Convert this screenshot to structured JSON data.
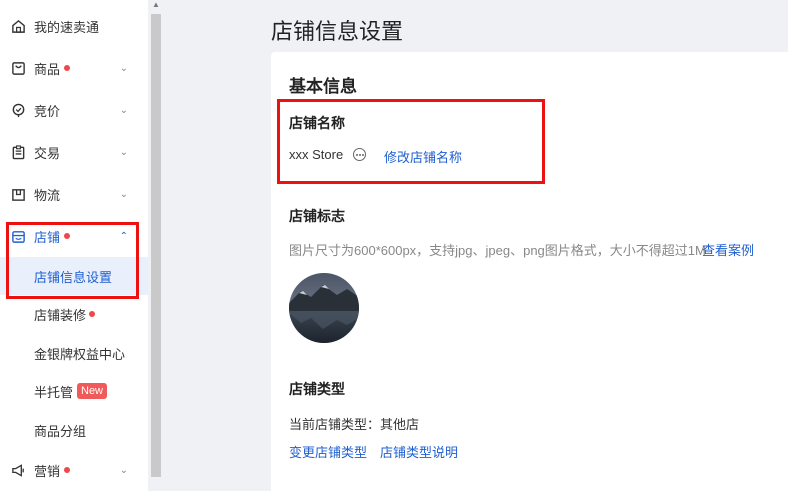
{
  "sidebar": {
    "items": [
      {
        "label": "我的速卖通",
        "icon": "home-icon"
      },
      {
        "label": "商品",
        "icon": "bag-icon",
        "dot": true
      },
      {
        "label": "竞价",
        "icon": "check-circle-icon"
      },
      {
        "label": "交易",
        "icon": "clipboard-icon"
      },
      {
        "label": "物流",
        "icon": "box-icon"
      },
      {
        "label": "店铺",
        "icon": "store-icon",
        "dot": true,
        "expanded": true
      },
      {
        "label": "营销",
        "icon": "megaphone-icon",
        "dot": true
      }
    ],
    "sub_items": [
      {
        "label": "店铺信息设置",
        "active": true
      },
      {
        "label": "店铺装修",
        "dot": true
      },
      {
        "label": "金银牌权益中心"
      },
      {
        "label": "半托管",
        "badge": "New"
      },
      {
        "label": "商品分组"
      }
    ]
  },
  "main": {
    "page_title": "店铺信息设置",
    "section_title": "基本信息",
    "store_name": {
      "title": "店铺名称",
      "value": "xxx Store",
      "edit_link": "修改店铺名称"
    },
    "store_logo": {
      "title": "店铺标志",
      "hint": "图片尺寸为600*600px，支持jpg、jpeg、png图片格式，大小不得超过1M",
      "example_link": "查看案例"
    },
    "store_type": {
      "title": "店铺类型",
      "current": "当前店铺类型：其他店",
      "change_link": "变更店铺类型",
      "explain_link": "店铺类型说明"
    }
  },
  "colors": {
    "accent": "#1f5fd0",
    "dot": "#f04848",
    "highlight_box": "#e11111",
    "active_bg": "#e9f0fc"
  }
}
